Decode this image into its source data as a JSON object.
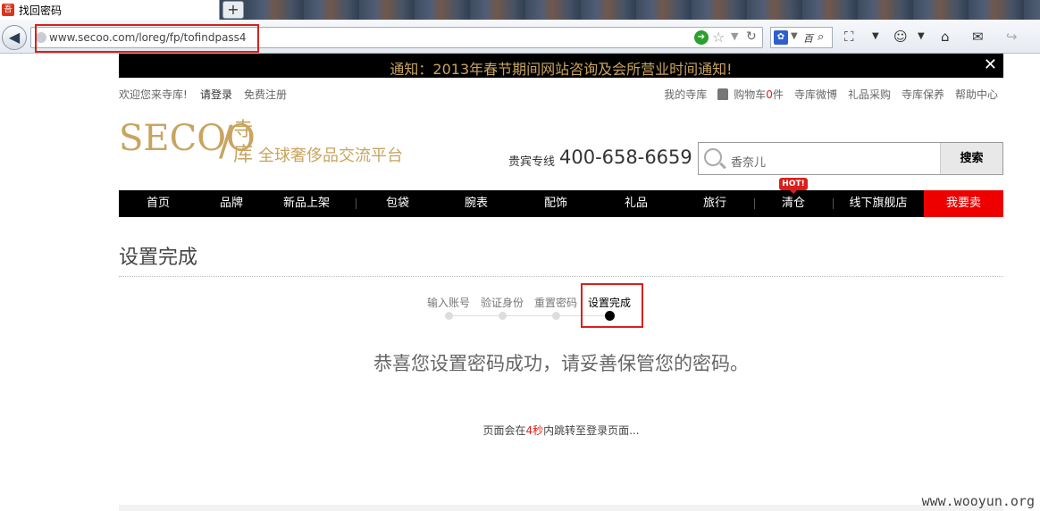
{
  "browser": {
    "tab_title": "找回密码",
    "tab_favicon": "吾",
    "new_tab": "+",
    "back": "◀",
    "url": "www.secoo.com/loreg/fp/tofindpass4",
    "search_text": "百"
  },
  "notice": {
    "text": "通知：2013年春节期间网站咨询及会所营业时间通知!",
    "close": "✕"
  },
  "topbar": {
    "welcome": "欢迎您来寺库!",
    "login": "请登录",
    "register": "免费注册",
    "my_secoo": "我的寺库",
    "cart_label": "购物车",
    "cart_count": "0",
    "cart_unit": "件",
    "weibo": "寺库微博",
    "gift": "礼品采购",
    "care": "寺库保养",
    "help": "帮助中心"
  },
  "logo": {
    "brand": "SECOO",
    "slash": "/",
    "chars": "寺库",
    "slogan": "全球奢侈品交流平台"
  },
  "hotline": {
    "label": "贵宾专线",
    "number": "400-658-6659"
  },
  "site_search": {
    "placeholder": "香奈儿",
    "button": "搜索"
  },
  "nav": {
    "items": [
      "首页",
      "品牌",
      "新品上架",
      "包袋",
      "腕表",
      "配饰",
      "礼品",
      "旅行",
      "清仓",
      "线下旗舰店"
    ],
    "hot_badge": "HOT!",
    "sell": "我要卖"
  },
  "page": {
    "heading": "设置完成",
    "steps": [
      "输入账号",
      "验证身份",
      "重置密码",
      "设置完成"
    ],
    "active_step": 4,
    "success": "恭喜您设置密码成功，请妥善保管您的密码。",
    "redirect_prefix": "页面会在",
    "redirect_count": "4秒",
    "redirect_suffix": "内跳转至登录页面..."
  },
  "watermark": "www.wooyun.org",
  "colors": {
    "gold": "#c8a45f",
    "highlight_red": "#d9201c",
    "sell_red": "#e00000"
  }
}
